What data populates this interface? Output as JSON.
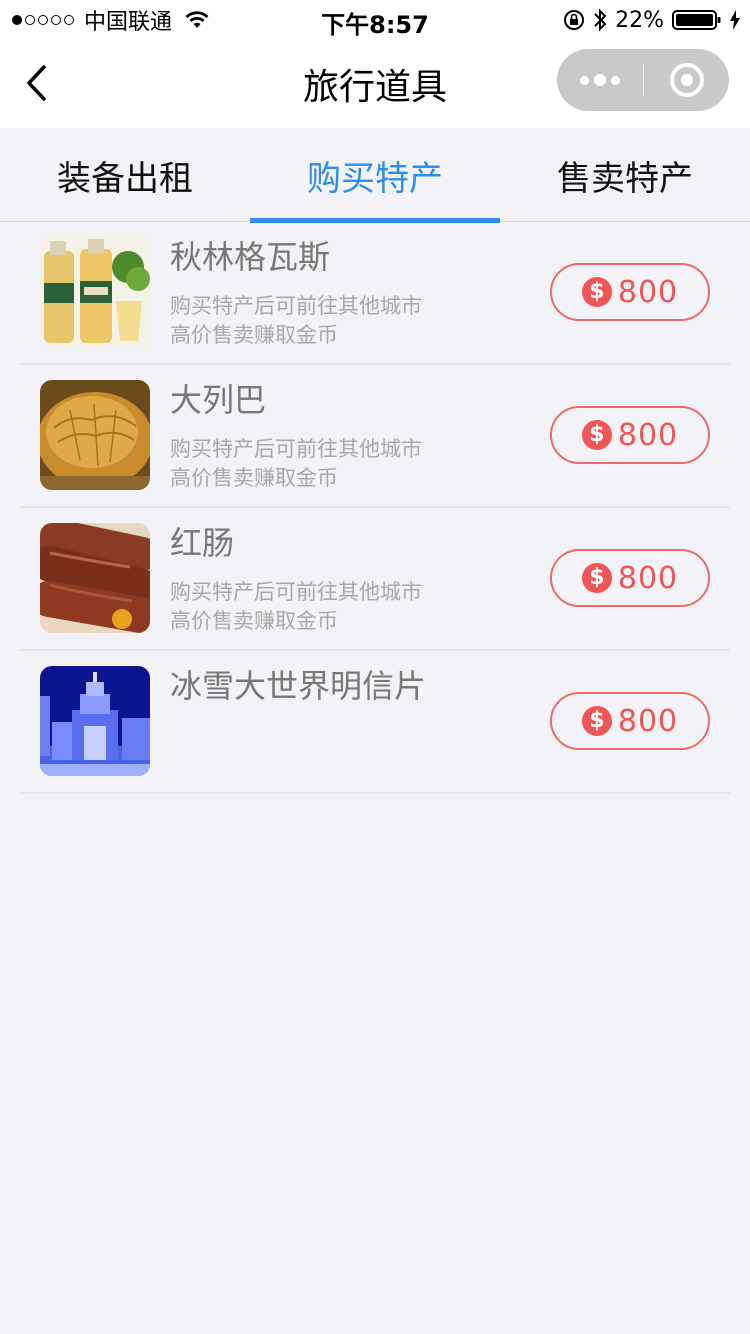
{
  "status_bar": {
    "carrier": "中国联通",
    "time": "下午8:57",
    "battery": "22%"
  },
  "nav": {
    "title": "旅行道具",
    "back_icon": "chevron-left-icon",
    "more_icon": "more-dots-icon",
    "close_icon": "target-ring-icon"
  },
  "tabs": [
    {
      "label": "装备出租",
      "active": false
    },
    {
      "label": "购买特产",
      "active": true
    },
    {
      "label": "售卖特产",
      "active": false
    }
  ],
  "items": [
    {
      "name": "秋林格瓦斯",
      "desc_line1": "购买特产后可前往其他城市",
      "desc_line2": "高价售卖赚取金币",
      "price": "800",
      "thumb": "kvass-bottles"
    },
    {
      "name": "大列巴",
      "desc_line1": "购买特产后可前往其他城市",
      "desc_line2": "高价售卖赚取金币",
      "price": "800",
      "thumb": "bread-loaf"
    },
    {
      "name": "红肠",
      "desc_line1": "购买特产后可前往其他城市",
      "desc_line2": "高价售卖赚取金币",
      "price": "800",
      "thumb": "red-sausage"
    },
    {
      "name": "冰雪大世界明信片",
      "desc_line1": "",
      "desc_line2": "",
      "price": "800",
      "thumb": "ice-castle"
    }
  ],
  "currency_symbol": "$",
  "colors": {
    "accent": "#2f8cf1",
    "price": "#f15555",
    "background": "#f3f2f7"
  }
}
